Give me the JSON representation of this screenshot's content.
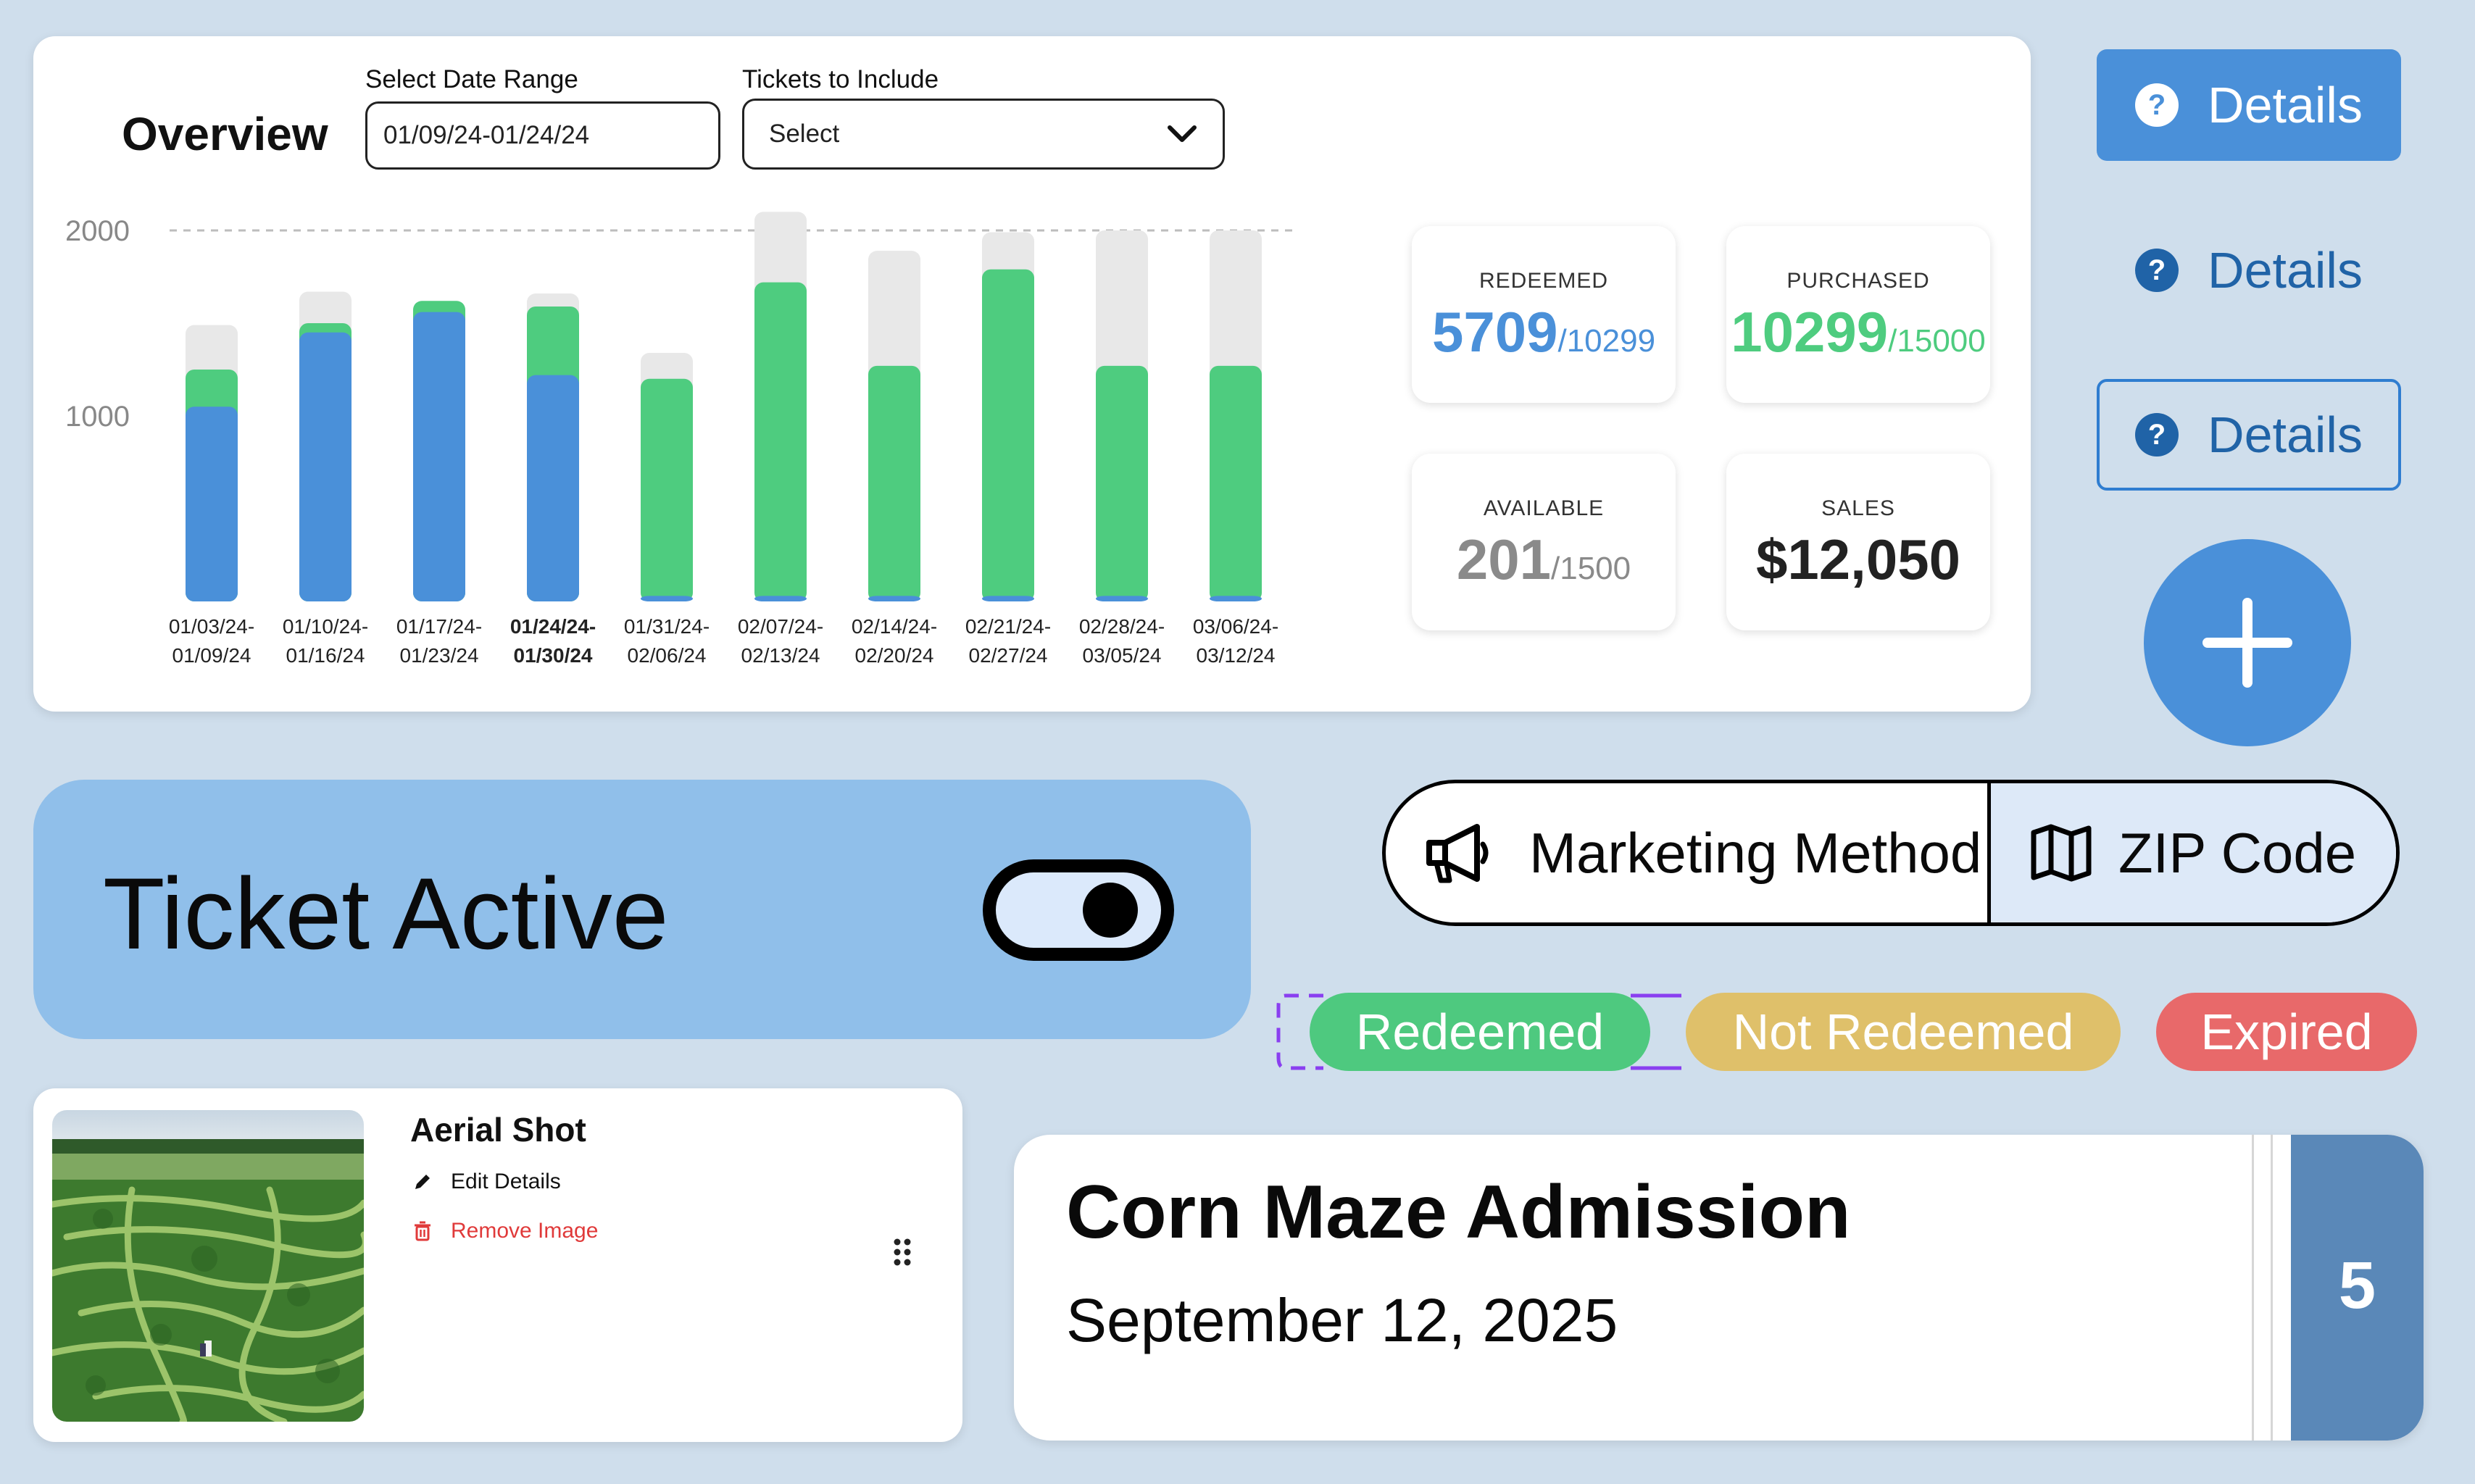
{
  "overview": {
    "title": "Overview",
    "date_range": {
      "label": "Select Date Range",
      "value": "01/09/24-01/24/24"
    },
    "tickets_filter": {
      "label": "Tickets to Include",
      "value": "Select"
    }
  },
  "chart_data": {
    "type": "bar",
    "stacked": true,
    "ylim": [
      0,
      2000
    ],
    "yticks": [
      1000,
      2000
    ],
    "grid": "dashed line at 2000",
    "categories": [
      [
        "01/03/24-",
        "01/09/24"
      ],
      [
        "01/10/24-",
        "01/16/24"
      ],
      [
        "01/17/24-",
        "01/23/24"
      ],
      [
        "01/24/24-",
        "01/30/24"
      ],
      [
        "01/31/24-",
        "02/06/24"
      ],
      [
        "02/07/24-",
        "02/13/24"
      ],
      [
        "02/14/24-",
        "02/20/24"
      ],
      [
        "02/21/24-",
        "02/27/24"
      ],
      [
        "02/28/24-",
        "03/05/24"
      ],
      [
        "03/06/24-",
        "03/12/24"
      ]
    ],
    "selected_category": 3,
    "series": [
      {
        "color": "#4a90d9",
        "values": [
          1050,
          1450,
          1560,
          1220,
          30,
          30,
          30,
          30,
          30,
          30
        ]
      },
      {
        "color": "#4ecc7f",
        "values": [
          200,
          50,
          60,
          370,
          1170,
          1690,
          1240,
          1760,
          1240,
          1240
        ]
      },
      {
        "color": "#e8e8e8",
        "values": [
          240,
          170,
          0,
          70,
          140,
          380,
          620,
          200,
          730,
          730
        ]
      }
    ]
  },
  "stats": {
    "redeemed": {
      "label": "REDEEMED",
      "value": "5709",
      "total": "/10299",
      "color": "#4a90d9"
    },
    "purchased": {
      "label": "PURCHASED",
      "value": "10299",
      "total": "/15000",
      "color": "#4ecc7f"
    },
    "available": {
      "label": "AVAILABLE",
      "value": "201",
      "total": "/1500",
      "color": "#8a8a8a"
    },
    "sales": {
      "label": "SALES",
      "value": "$12,050",
      "color": "#222222"
    }
  },
  "buttons": {
    "details_filled": "Details",
    "details_text": "Details",
    "details_outline": "Details",
    "help_icon": "?",
    "add_icon": "plus-icon"
  },
  "ticket_active": {
    "label": "Ticket Active",
    "enabled": true
  },
  "segment": {
    "option1": "Marketing Method",
    "option2": "ZIP Code",
    "selected": "ZIP Code"
  },
  "chips": {
    "redeemed": "Redeemed",
    "not_redeemed": "Not Redeemed",
    "expired": "Expired"
  },
  "image_card": {
    "title": "Aerial Shot",
    "edit_label": "Edit Details",
    "remove_label": "Remove Image"
  },
  "event": {
    "title": "Corn Maze Admission",
    "date": "September 12, 2025",
    "count": "5"
  },
  "colors": {
    "brand_blue": "#4a90d9",
    "green": "#4ecc7f",
    "yellow": "#dfc06a",
    "red": "#e8696a",
    "background": "#cfdeec"
  }
}
